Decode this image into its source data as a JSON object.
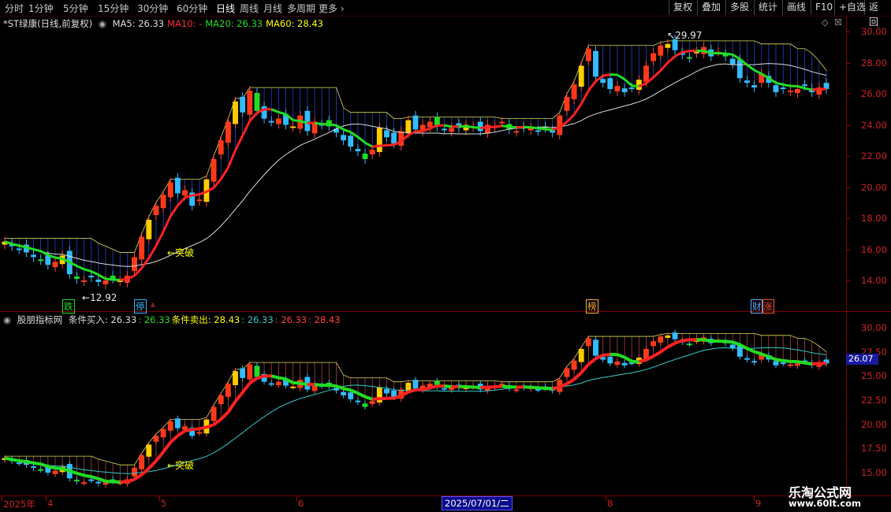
{
  "toolbar": {
    "periods": [
      "分时",
      "1分钟",
      "5分钟",
      "15分钟",
      "30分钟",
      "60分钟",
      "日线",
      "周线",
      "月线",
      "多周期",
      "更多"
    ],
    "active_period": "日线",
    "right_buttons": [
      "复权",
      "叠加",
      "多股",
      "统计",
      "画线",
      "F10",
      "+自选",
      "返回"
    ]
  },
  "main_panel": {
    "title": "*ST绿康(日线,前复权)",
    "ma": [
      {
        "label": "MA5: 26.33",
        "color": "#dddddd"
      },
      {
        "label": "MA10: -",
        "color": "#ff3030"
      },
      {
        "label": "MA20: 26.33",
        "color": "#22dd22"
      },
      {
        "label": "MA60: 28.43",
        "color": "#ffff00"
      }
    ],
    "yticks": [
      "30.00",
      "28.00",
      "26.00",
      "24.00",
      "22.00",
      "20.00",
      "18.00",
      "16.00",
      "14.00"
    ],
    "high_label": "29.97",
    "low_label": "12.92",
    "break_label": "突破",
    "event_tags": [
      {
        "text": "跌",
        "color": "#22dd22"
      },
      {
        "text": "停",
        "color": "#33bbff"
      },
      {
        "text": "榜",
        "color": "#ffaa33"
      },
      {
        "text": "财",
        "color": "#66aaff"
      },
      {
        "text": "涨",
        "color": "#ff5533"
      }
    ]
  },
  "sub_panel": {
    "title": "股朋指标网",
    "values": [
      {
        "label": "条件买入: 26.33",
        "color": "#dddddd"
      },
      {
        "label": ": 26.33",
        "color": "#22dd22"
      },
      {
        "label": "条件卖出: 28.43",
        "color": "#ffff00"
      },
      {
        "label": ": 26.33",
        "color": "#33cccc"
      },
      {
        "label": ": 26.33",
        "color": "#ff4040"
      },
      {
        "label": ": 28.43",
        "color": "#ff4040"
      }
    ],
    "yticks": [
      "30.00",
      "27.50",
      "25.00",
      "22.50",
      "20.00",
      "17.50",
      "15.00"
    ],
    "price_flag": "26.07",
    "break_label": "突破"
  },
  "xaxis": {
    "labels": [
      "2025年",
      "4",
      "5",
      "6",
      "2025/07/01/二",
      "8",
      "9"
    ]
  },
  "watermark": {
    "line1": "乐淘公式网",
    "line2": "www.60lt.com"
  },
  "colors": {
    "up": "#ff3030",
    "down": "#33bbff",
    "ma_line": "#ff2222",
    "ma_green": "#22dd22",
    "slow_line": "#dddddd",
    "cloud": "#2244cc"
  },
  "chart_data": {
    "type": "candlestick",
    "closes": [
      16.5,
      16.2,
      16.0,
      15.8,
      15.5,
      15.3,
      15.0,
      15.2,
      15.6,
      14.4,
      14.1,
      14.0,
      14.2,
      13.9,
      14.0,
      14.1,
      14.0,
      14.3,
      15.5,
      16.8,
      17.9,
      18.8,
      19.5,
      20.3,
      19.6,
      19.8,
      18.8,
      19.2,
      20.5,
      21.8,
      23.0,
      24.2,
      25.5,
      24.8,
      26.2,
      24.9,
      24.4,
      24.2,
      24.4,
      24.0,
      23.9,
      24.6,
      23.6,
      24.2,
      24.0,
      23.9,
      23.5,
      23.0,
      22.6,
      22.3,
      21.8,
      22.4,
      23.8,
      23.2,
      22.8,
      23.6,
      24.3,
      23.7,
      24.0,
      24.2,
      23.9,
      23.7,
      23.8,
      23.8,
      24.0,
      23.9,
      23.6,
      24.0,
      23.9,
      24.2,
      23.7,
      23.6,
      23.8,
      23.8,
      23.6,
      23.8,
      23.5,
      24.6,
      25.8,
      26.6,
      27.8,
      28.9,
      27.1,
      26.7,
      26.3,
      26.5,
      26.1,
      26.4,
      26.9,
      27.8,
      28.6,
      29.1,
      29.2,
      28.8,
      28.5,
      28.3,
      28.7,
      29.0,
      28.4,
      28.7,
      28.4,
      27.9,
      27.0,
      26.7,
      26.4,
      27.3,
      26.7,
      26.1,
      26.3,
      26.2,
      26.3,
      26.5,
      26.1,
      26.4,
      26.3
    ],
    "ylim": [
      12.5,
      31
    ]
  }
}
